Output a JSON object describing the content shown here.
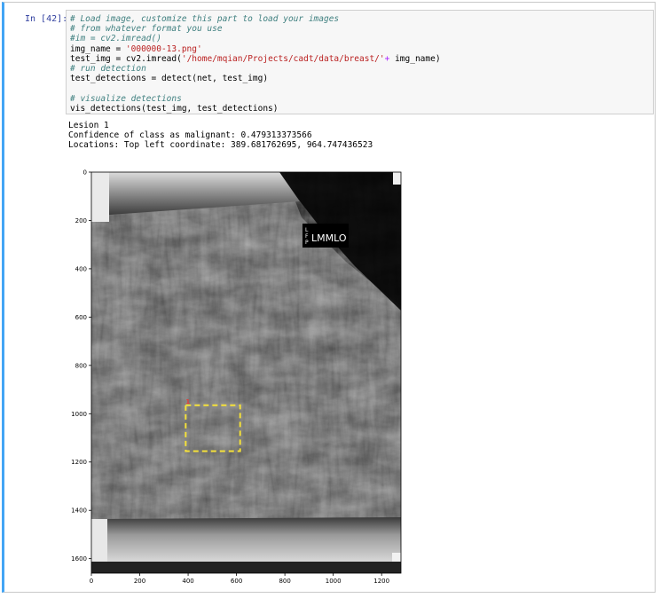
{
  "prompt": "In [42]:",
  "code": {
    "line1": "# Load image, customize this part to load your images",
    "line2": "# from whatever format you use",
    "line3": "#im = cv2.imread()",
    "line4_var": "img_name = ",
    "line4_str": "'000000-13.png'",
    "line5_pre": "test_img = cv2.imread(",
    "line5_str": "'/home/mqian/Projects/cadt/data/breast/'",
    "line5_op": "+",
    "line5_post": " img_name)",
    "line6": "# run detection",
    "line7": "test_detections = detect(net, test_img)",
    "line8": "",
    "line9": "# visualize detections",
    "line10": "vis_detections(test_img, test_detections)"
  },
  "output": {
    "line1": "Lesion 1",
    "line2": "Confidence of class as malignant: 0.479313373566",
    "line3": "Locations: Top left coordinate: 389.681762695, 964.747436523"
  },
  "figure": {
    "image_label": "LMMLO",
    "side_letters": [
      "L",
      "F",
      "P"
    ],
    "detection_tag": "1",
    "box_color": "#f5e13a",
    "x_ticks": [
      "0",
      "200",
      "400",
      "600",
      "800",
      "1000",
      "1200"
    ],
    "y_ticks": [
      "0",
      "200",
      "400",
      "600",
      "800",
      "1000",
      "1200",
      "1400",
      "1600"
    ],
    "detection_box": {
      "x": 390,
      "y": 965,
      "w": 225,
      "h": 190
    }
  }
}
